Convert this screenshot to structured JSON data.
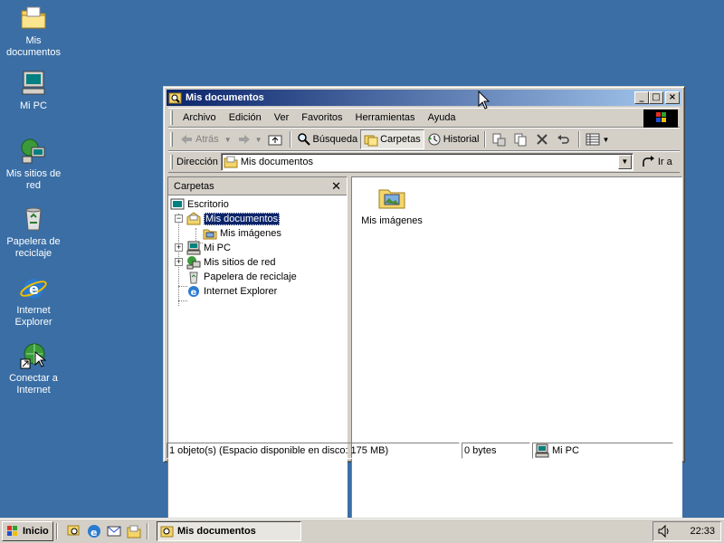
{
  "desktop": {
    "icons": [
      {
        "label": "Mis documentos",
        "icon": "folder-documents-icon"
      },
      {
        "label": "Mi PC",
        "icon": "computer-icon"
      },
      {
        "label": "Mis sitios de red",
        "icon": "network-icon"
      },
      {
        "label": "Papelera de reciclaje",
        "icon": "recycle-bin-icon"
      },
      {
        "label": "Internet Explorer",
        "icon": "internet-explorer-icon"
      },
      {
        "label": "Conectar a Internet",
        "icon": "connect-internet-icon"
      }
    ]
  },
  "window": {
    "title": "Mis documentos",
    "menu": [
      "Archivo",
      "Edición",
      "Ver",
      "Favoritos",
      "Herramientas",
      "Ayuda"
    ],
    "toolbar": {
      "back": "Atrás",
      "search": "Búsqueda",
      "folders": "Carpetas",
      "history": "Historial"
    },
    "address": {
      "label": "Dirección",
      "value": "Mis documentos",
      "go": "Ir a"
    },
    "folders_pane": {
      "title": "Carpetas",
      "tree": [
        {
          "label": "Escritorio",
          "icon": "desktop-icon"
        },
        {
          "label": "Mis documentos",
          "icon": "folder-documents-icon",
          "selected": true
        },
        {
          "label": "Mis imágenes",
          "icon": "folder-pictures-icon"
        },
        {
          "label": "Mi PC",
          "icon": "computer-icon"
        },
        {
          "label": "Mis sitios de red",
          "icon": "network-icon"
        },
        {
          "label": "Papelera de reciclaje",
          "icon": "recycle-bin-icon"
        },
        {
          "label": "Internet Explorer",
          "icon": "internet-explorer-icon"
        }
      ]
    },
    "content": {
      "items": [
        {
          "label": "Mis imágenes",
          "icon": "folder-pictures-icon"
        }
      ]
    },
    "status": {
      "objects": "1 objeto(s) (Espacio disponible en disco:  175 MB)",
      "size": "0 bytes",
      "location": "Mi PC"
    }
  },
  "taskbar": {
    "start": "Inicio",
    "task": "Mis documentos",
    "clock": "22:33"
  },
  "colors": {
    "desktop": "#3a6ea5",
    "title_active": "#0a246a",
    "chrome": "#d4d0c8"
  }
}
